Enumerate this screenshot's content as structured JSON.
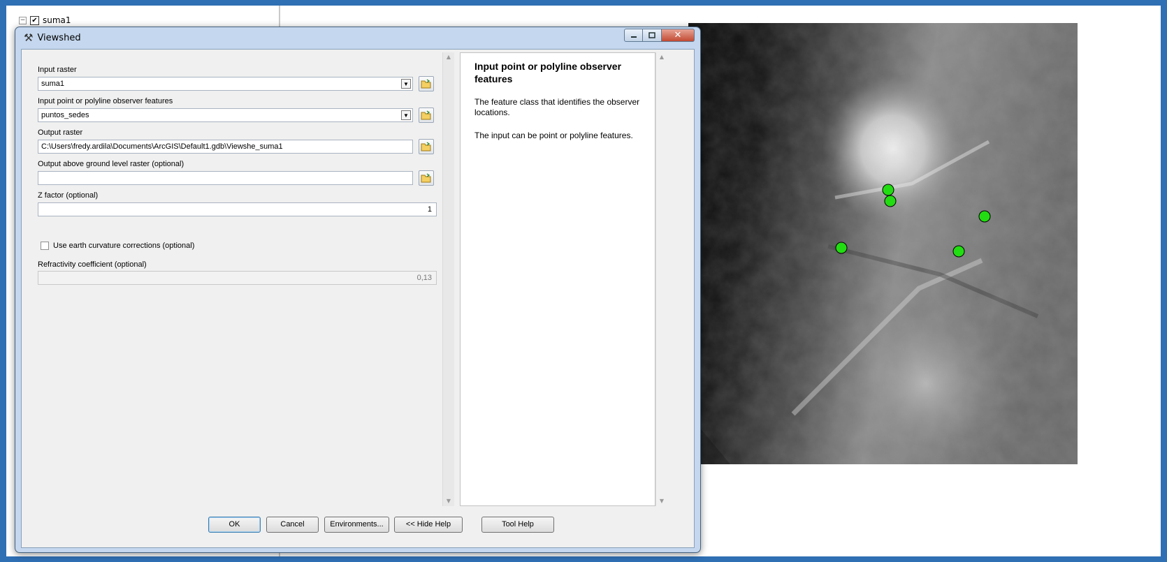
{
  "toc": {
    "layer_name": "suma1"
  },
  "dialog": {
    "title": "Viewshed",
    "params": {
      "input_raster_label": "Input raster",
      "input_raster_value": "suma1",
      "observer_label": "Input point or polyline observer features",
      "observer_value": "puntos_sedes",
      "output_raster_label": "Output raster",
      "output_raster_value": "C:\\Users\\fredy.ardila\\Documents\\ArcGIS\\Default1.gdb\\Viewshe_suma1",
      "agl_label": "Output above ground level raster (optional)",
      "agl_value": "",
      "z_factor_label": "Z factor (optional)",
      "z_factor_value": "1",
      "curvature_label": "Use earth curvature corrections (optional)",
      "refractivity_label": "Refractivity coefficient (optional)",
      "refractivity_value": "0,13"
    },
    "help": {
      "title": "Input point or polyline observer features",
      "p1": "The feature class that identifies the observer locations.",
      "p2": "The input can be point or polyline features."
    },
    "buttons": {
      "ok": "OK",
      "cancel": "Cancel",
      "environments": "Environments...",
      "hide_help": "<< Hide Help",
      "tool_help": "Tool Help"
    }
  },
  "map": {
    "observer_color": "#22dd11",
    "observer_points": 5
  },
  "colors": {
    "frame": "#2f6fb4",
    "dialog_chrome": "#c4d7ee"
  }
}
